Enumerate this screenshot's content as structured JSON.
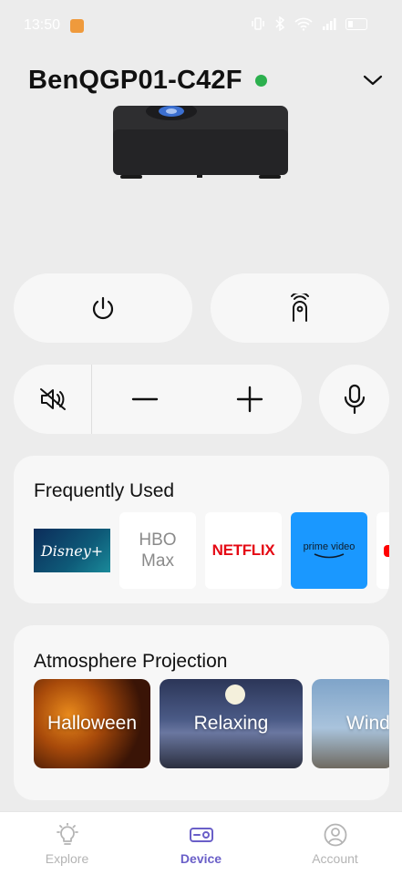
{
  "status_bar": {
    "time": "13:50",
    "battery_label": "33"
  },
  "device": {
    "name": "BenQGP01-C42F",
    "online": true,
    "online_color": "#2cb04e"
  },
  "controls": {
    "icons": [
      "power-icon",
      "remote-icon",
      "volume-mute-icon",
      "minus-icon",
      "plus-icon",
      "microphone-icon"
    ]
  },
  "frequently_used": {
    "title": "Frequently Used",
    "apps": {
      "disney": "Disney+",
      "hbo_line1": "HBO",
      "hbo_line2": "Max",
      "netflix": "NETFLIX",
      "prime": "prime video"
    }
  },
  "atmosphere": {
    "title": "Atmosphere Projection",
    "scenes": {
      "halloween": "Halloween",
      "relaxing": "Relaxing",
      "window": "Wind"
    }
  },
  "tabs": {
    "explore": "Explore",
    "device": "Device",
    "account": "Account",
    "active": "Device",
    "active_color": "#6a5fc8"
  }
}
